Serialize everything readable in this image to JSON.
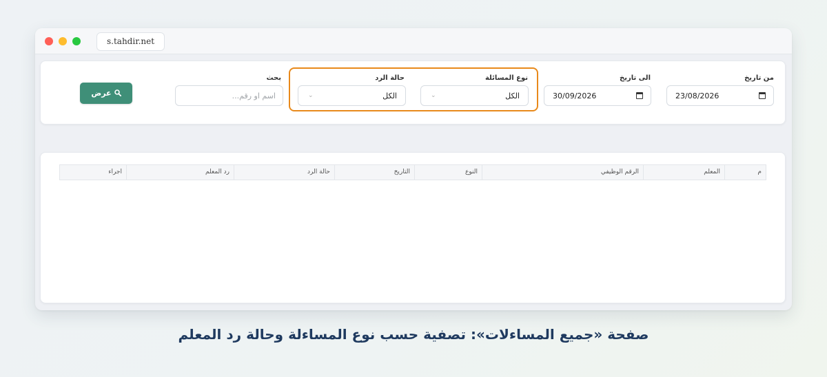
{
  "browser": {
    "url": "s.tahdir.net"
  },
  "filters": {
    "from_date": {
      "label": "من تاريخ",
      "value": "23/08/2026"
    },
    "to_date": {
      "label": "الى تاريخ",
      "value": "30/09/2026"
    },
    "question_type": {
      "label": "نوع المسائلة",
      "value": "الكل"
    },
    "reply_status": {
      "label": "حالة الرد",
      "value": "الكل"
    },
    "search": {
      "label": "بحث",
      "placeholder": "اسم او رقم..."
    },
    "show_button": "عرض"
  },
  "table": {
    "columns": [
      "م",
      "المعلم",
      "الرقم الوظيفي",
      "النوع",
      "التاريخ",
      "حالة الرد",
      "رد المعلم",
      "اجراء"
    ],
    "rows": []
  },
  "caption": "صفحة «جميع المساءلات»: تصفية حسب نوع المساءلة وحالة رد المعلم",
  "colors": {
    "accent": "#3f8f78",
    "highlight": "#e8891a",
    "caption": "#1f3a5f"
  }
}
